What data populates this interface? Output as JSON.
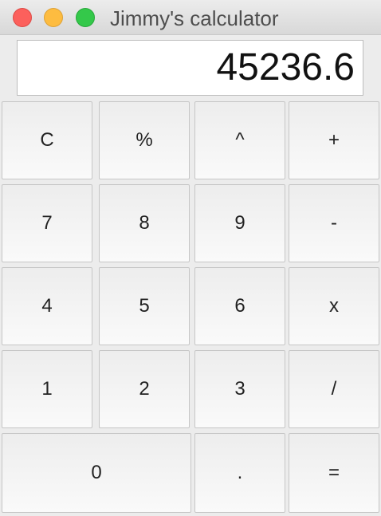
{
  "window": {
    "title": "Jimmy's calculator"
  },
  "display": {
    "value": "45236.6"
  },
  "keys": {
    "clear": "C",
    "percent": "%",
    "power": "^",
    "plus": "+",
    "seven": "7",
    "eight": "8",
    "nine": "9",
    "minus": "-",
    "four": "4",
    "five": "5",
    "six": "6",
    "multiply": "x",
    "one": "1",
    "two": "2",
    "three": "3",
    "divide": "/",
    "zero": "0",
    "decimal": ".",
    "equals": "="
  }
}
